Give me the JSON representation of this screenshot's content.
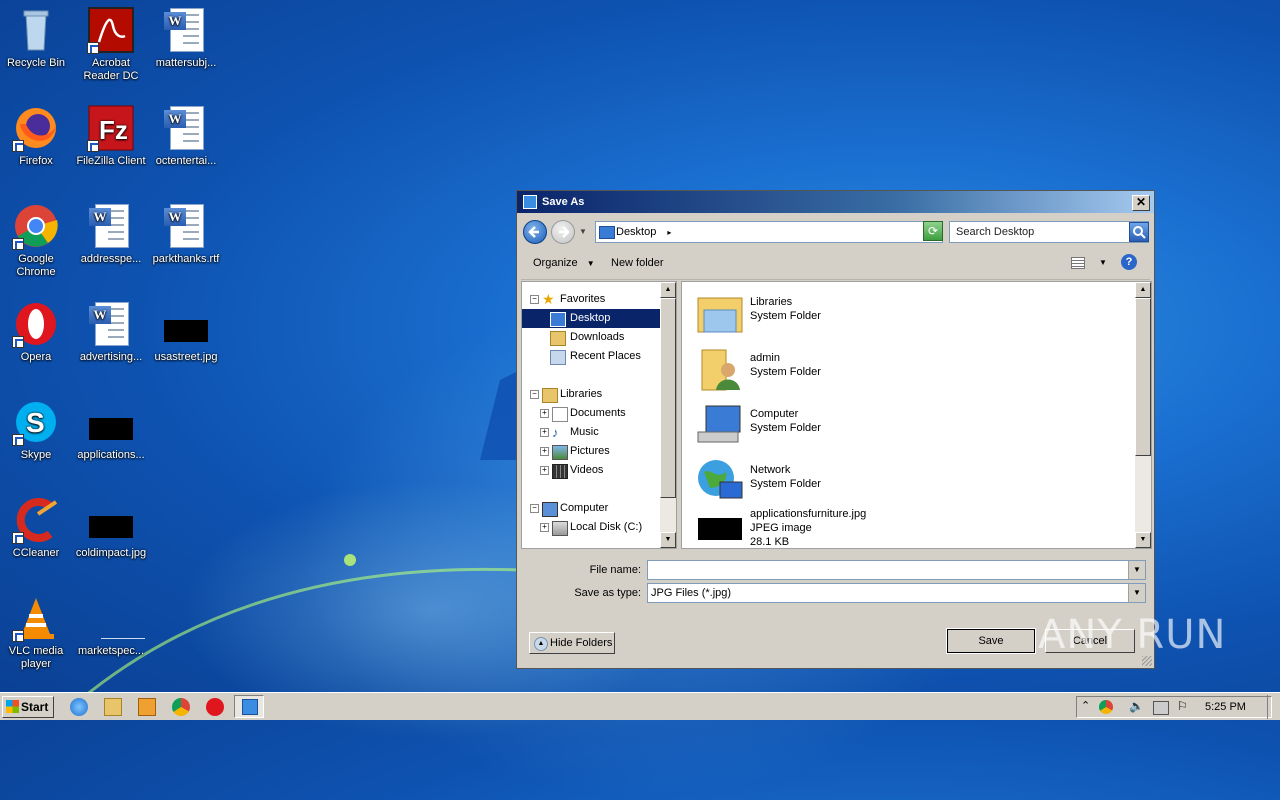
{
  "desktop": {
    "icons": [
      {
        "label": "Recycle Bin"
      },
      {
        "label": "Acrobat Reader DC"
      },
      {
        "label": "mattersubj..."
      },
      {
        "label": "Firefox"
      },
      {
        "label": "FileZilla Client"
      },
      {
        "label": "octentertai..."
      },
      {
        "label": "Google Chrome"
      },
      {
        "label": "addresspe..."
      },
      {
        "label": "parkthanks.rtf"
      },
      {
        "label": "Opera"
      },
      {
        "label": "advertising..."
      },
      {
        "label": "usastreet.jpg"
      },
      {
        "label": "Skype"
      },
      {
        "label": "applications..."
      },
      {
        "label": "CCleaner"
      },
      {
        "label": "coldimpact.jpg"
      },
      {
        "label": "VLC media player"
      },
      {
        "label": "marketspec..."
      }
    ]
  },
  "dialog": {
    "title": "Save As",
    "close_label": "✕",
    "address": "Desktop",
    "search_placeholder": "Search Desktop",
    "toolbar": {
      "organize": "Organize",
      "new_folder": "New folder"
    },
    "nav": {
      "favorites": "Favorites",
      "desktop": "Desktop",
      "downloads": "Downloads",
      "recent_places": "Recent Places",
      "libraries": "Libraries",
      "documents": "Documents",
      "music": "Music",
      "pictures": "Pictures",
      "videos": "Videos",
      "computer": "Computer",
      "local_disk": "Local Disk (C:)"
    },
    "files": [
      {
        "name": "Libraries",
        "type": "System Folder",
        "size": ""
      },
      {
        "name": "admin",
        "type": "System Folder",
        "size": ""
      },
      {
        "name": "Computer",
        "type": "System Folder",
        "size": ""
      },
      {
        "name": "Network",
        "type": "System Folder",
        "size": ""
      },
      {
        "name": "applicationsfurniture.jpg",
        "type": "JPEG image",
        "size": "28.1 KB"
      }
    ],
    "file_name_label": "File name:",
    "file_name_value": "",
    "save_type_label": "Save as type:",
    "save_type_value": "JPG Files (*.jpg)",
    "hide_folders": "Hide Folders",
    "save_button": "Save",
    "cancel_button": "Cancel"
  },
  "taskbar": {
    "start_label": "Start",
    "clock": "5:25 PM"
  },
  "watermark": "ANY RUN"
}
